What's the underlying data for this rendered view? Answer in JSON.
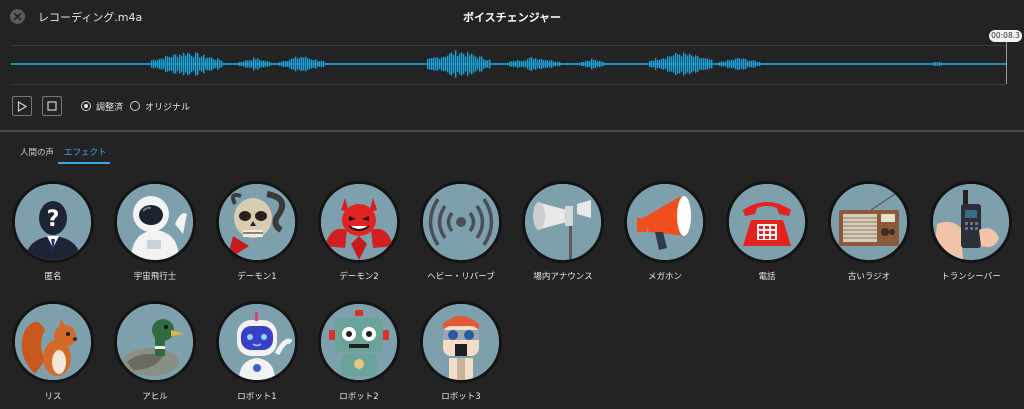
{
  "header": {
    "filename": "レコーディング.m4a",
    "title": "ボイスチェンジャー",
    "time": "00:08.3"
  },
  "modes": {
    "adjusted": "調整済",
    "original": "オリジナル"
  },
  "tabs": [
    "人間の声",
    "エフェクト"
  ],
  "effects": [
    "匿名",
    "宇宙飛行士",
    "デーモン1",
    "デーモン2",
    "ヘビー・リバーブ",
    "場内アナウンス",
    "メガホン",
    "電話",
    "古いラジオ",
    "トランシーバー",
    "リス",
    "アヒル",
    "ロボット1",
    "ロボット2",
    "ロボット3"
  ],
  "colors": {
    "accent": "#39a9e6",
    "waveform": "#1ca3dc",
    "background": "#232323",
    "tile": "#7d9aa6"
  },
  "icons": {
    "close": "close-icon",
    "play": "play-icon",
    "stop": "stop-icon"
  }
}
